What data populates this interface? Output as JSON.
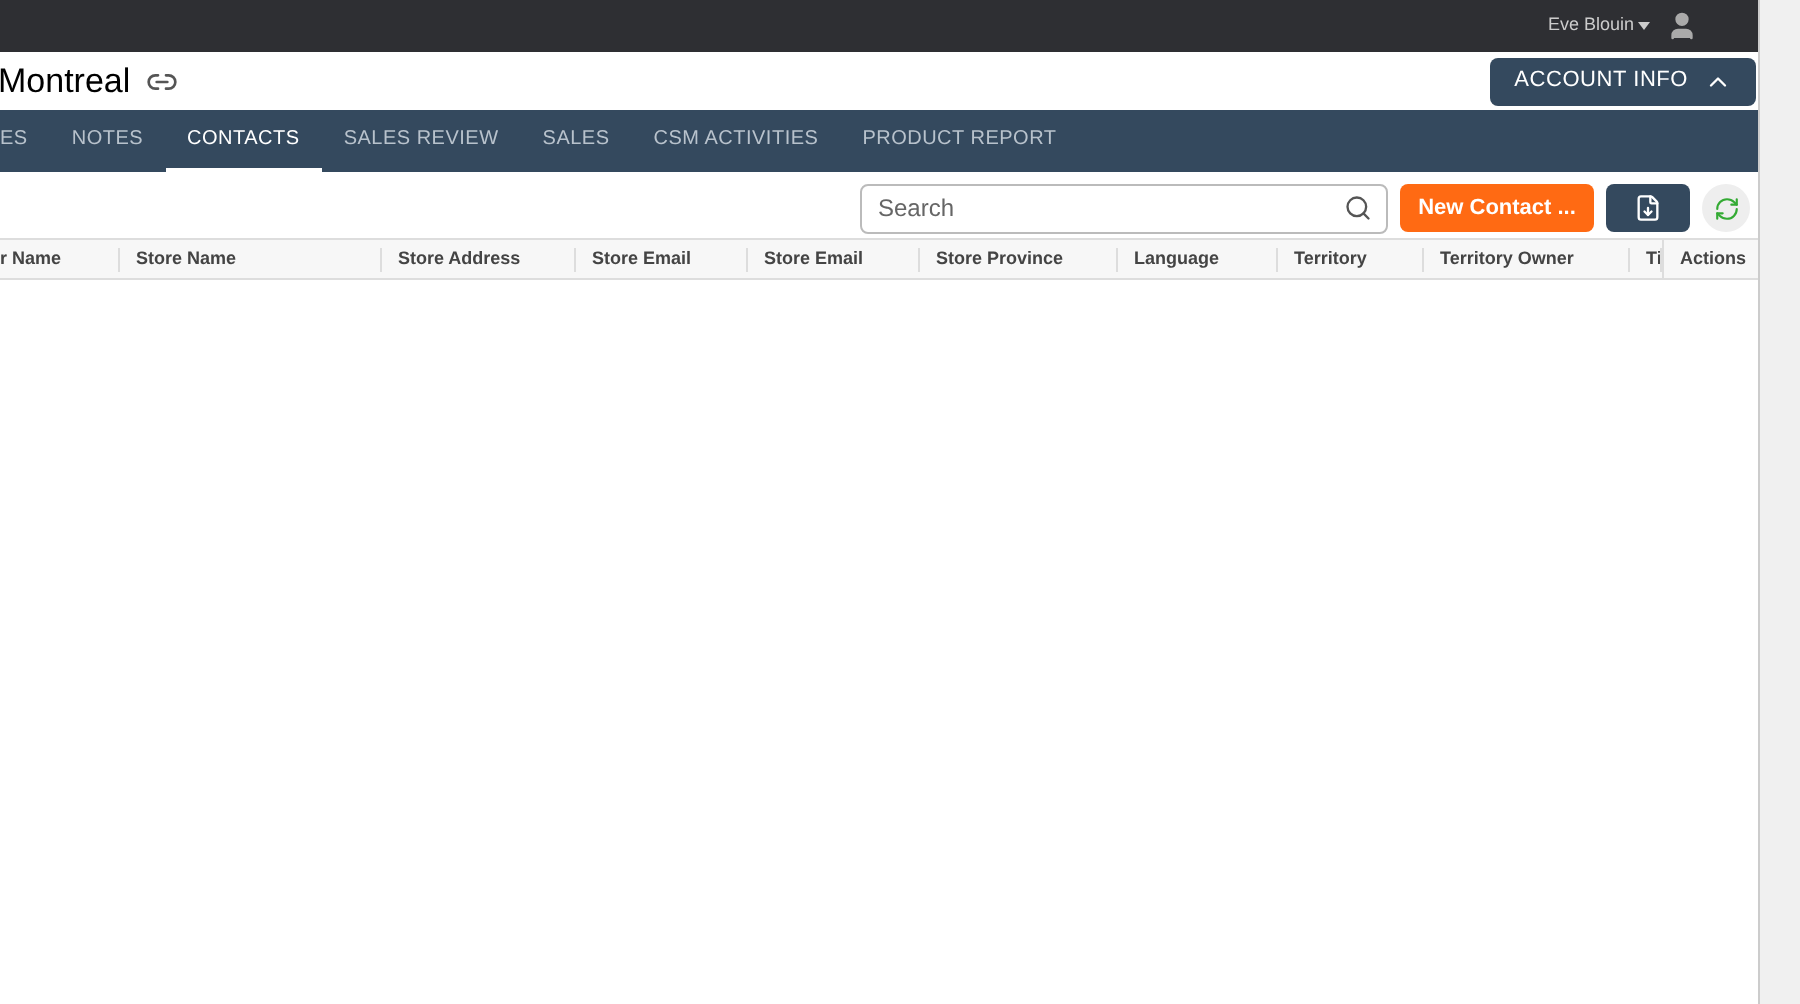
{
  "top_bar": {
    "user": "Eve Blouin"
  },
  "header": {
    "title": "Montreal",
    "account_button": "ACCOUNT INFO"
  },
  "tabs": [
    {
      "label": "ES",
      "selected": false
    },
    {
      "label": "NOTES",
      "selected": false
    },
    {
      "label": "CONTACTS",
      "selected": true
    },
    {
      "label": "SALES REVIEW",
      "selected": false
    },
    {
      "label": "SALES",
      "selected": false
    },
    {
      "label": "CSM ACTIVITIES",
      "selected": false
    },
    {
      "label": "PRODUCT REPORT",
      "selected": false
    }
  ],
  "toolbar": {
    "search": {
      "placeholder": "Search"
    },
    "new_button": "New Contact ..."
  },
  "table": {
    "columns": [
      "r Name",
      "Store Name",
      "Store Address",
      "Store Email",
      "Store Email",
      "Store Province",
      "Language",
      "Territory",
      "Territory Owner",
      "Ti"
    ],
    "actions": "Actions"
  }
}
